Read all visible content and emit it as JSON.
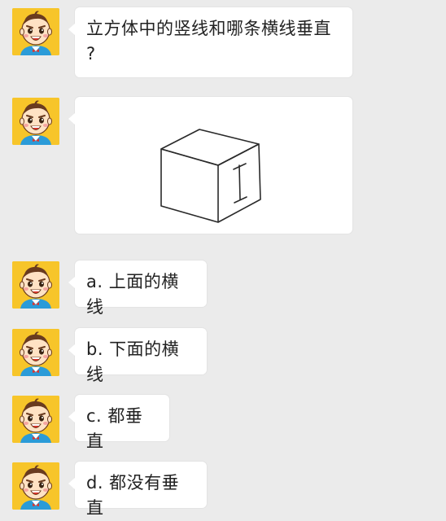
{
  "messages": [
    {
      "type": "text",
      "text": "立方体中的竖线和哪条横线垂直\n?"
    },
    {
      "type": "image",
      "image": "cube-diagram"
    },
    {
      "type": "text",
      "text": "a. 上面的横线"
    },
    {
      "type": "text",
      "text": "b. 下面的横线"
    },
    {
      "type": "text",
      "text": "c. 都垂直"
    },
    {
      "type": "text",
      "text": "d. 都没有垂直"
    }
  ],
  "avatar": {
    "icon": "cartoon-boy-avatar-icon",
    "background": "#f7c52a"
  },
  "colors": {
    "background": "#ebebeb",
    "bubble": "#ffffff",
    "text": "#222222"
  }
}
